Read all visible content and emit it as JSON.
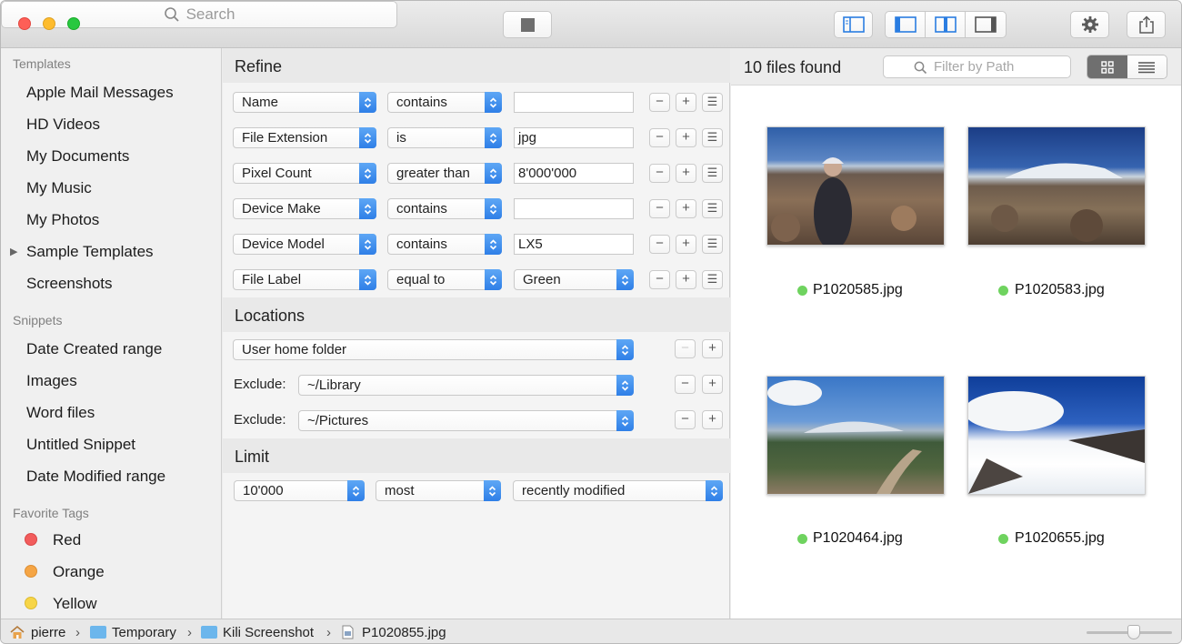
{
  "toolbar": {
    "search_placeholder": "Search"
  },
  "sidebar": {
    "templates_header": "Templates",
    "templates": [
      "Apple Mail Messages",
      "HD Videos",
      "My Documents",
      "My Music",
      "My Photos",
      "Sample Templates",
      "Screenshots"
    ],
    "snippets_header": "Snippets",
    "snippets": [
      "Date Created range",
      "Images",
      "Word files",
      "Untitled Snippet",
      "Date Modified range"
    ],
    "tags_header": "Favorite Tags",
    "tags": [
      {
        "label": "Red",
        "color": "#f25c5c"
      },
      {
        "label": "Orange",
        "color": "#f5a545"
      },
      {
        "label": "Yellow",
        "color": "#f7d547"
      }
    ]
  },
  "refine": {
    "title": "Refine",
    "rows": [
      {
        "attr": "Name",
        "op": "contains",
        "value": ""
      },
      {
        "attr": "File Extension",
        "op": "is",
        "value": "jpg"
      },
      {
        "attr": "Pixel Count",
        "op": "greater than",
        "value": "8'000'000"
      },
      {
        "attr": "Device Make",
        "op": "contains",
        "value": ""
      },
      {
        "attr": "Device Model",
        "op": "contains",
        "value": "LX5"
      },
      {
        "attr": "File Label",
        "op": "equal to",
        "value": "Green"
      }
    ]
  },
  "locations": {
    "title": "Locations",
    "folder": "User home folder",
    "exclude_label": "Exclude:",
    "excludes": [
      "~/Library",
      "~/Pictures"
    ]
  },
  "limit": {
    "title": "Limit",
    "count": "10'000",
    "order": "most",
    "criterion": "recently modified"
  },
  "results": {
    "count_text": "10 files found",
    "filter_placeholder": "Filter by Path",
    "files": [
      "P1020585.jpg",
      "P1020583.jpg",
      "P1020464.jpg",
      "P1020655.jpg"
    ],
    "label_color": "#6fd35f"
  },
  "pathbar": [
    "pierre",
    "Temporary",
    "Kili Screenshot",
    "P1020855.jpg"
  ]
}
